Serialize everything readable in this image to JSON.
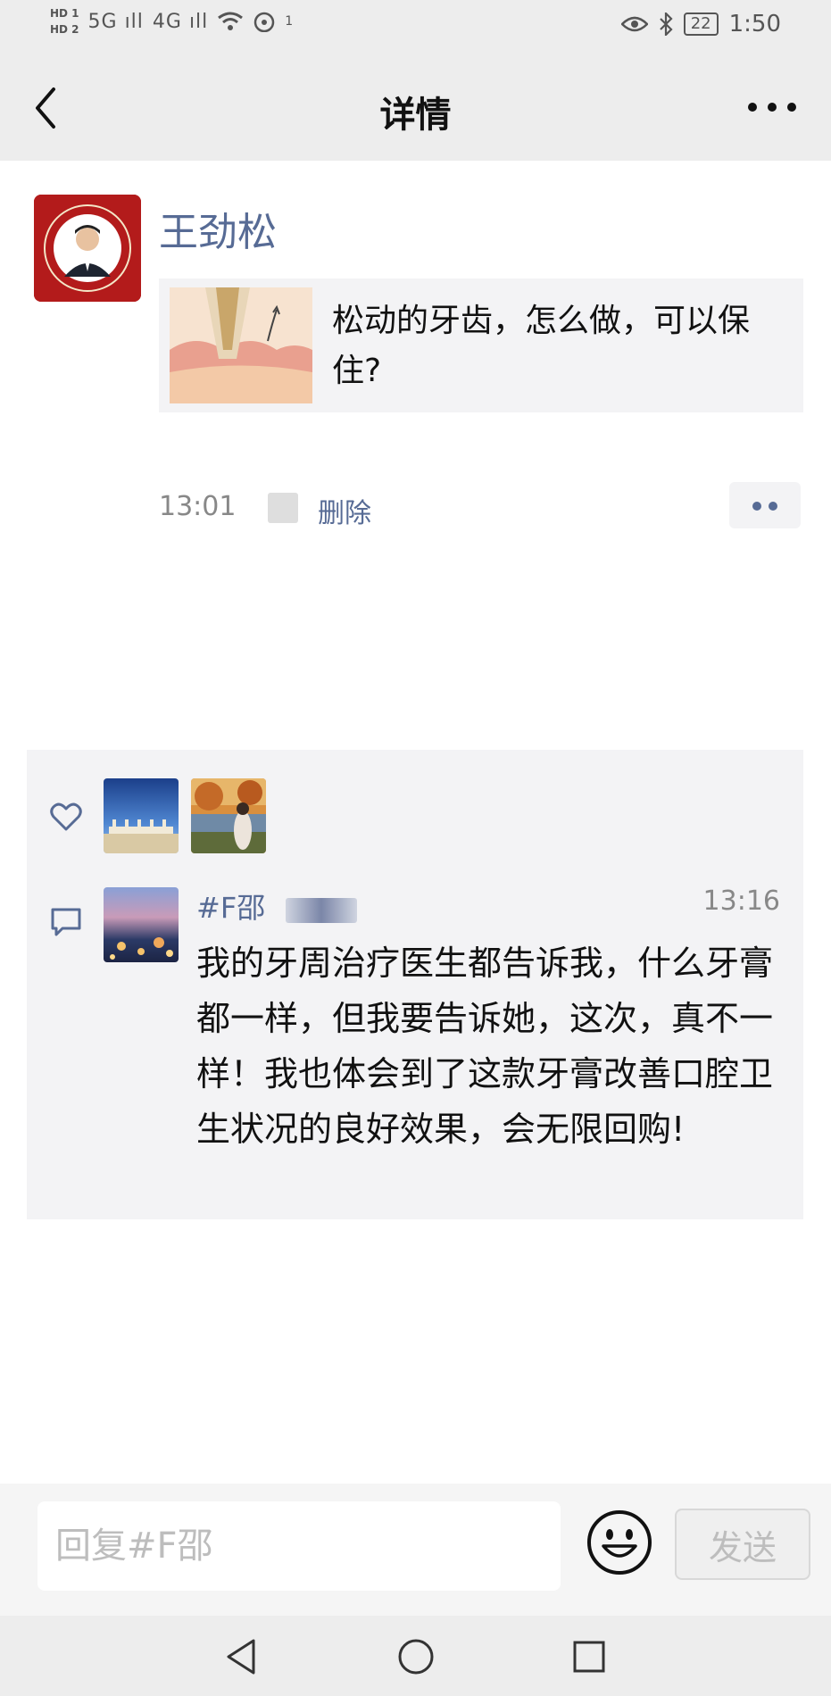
{
  "status_bar": {
    "hd1": "HD 1",
    "hd2": "HD 2",
    "signal1": "5G ıll",
    "signal2": "4G ıll",
    "hotspot": "1",
    "battery": "22",
    "time": "1:50"
  },
  "nav": {
    "title": "详情"
  },
  "post": {
    "author": "王劲松",
    "share_title": "松动的牙齿，怎么做，可以保住?",
    "time": "13:01",
    "delete_label": "删除"
  },
  "comment": {
    "name": "#F邵",
    "time": "13:16",
    "text": "我的牙周治疗医生都告诉我，什么牙膏都一样，但我要告诉她，这次，真不一样！我也体会到了这款牙膏改善口腔卫生状况的良好效果，会无限回购!"
  },
  "reply": {
    "placeholder": "回复#F邵",
    "send_label": "发送"
  },
  "colors": {
    "link_blue": "#576b95",
    "header_bg": "#ededed",
    "panel_bg": "#f3f3f5"
  },
  "icons": [
    "back-icon",
    "more-icon",
    "heart-icon",
    "comment-icon",
    "emoji-icon",
    "triangle-back-icon",
    "circle-home-icon",
    "square-recents-icon"
  ]
}
